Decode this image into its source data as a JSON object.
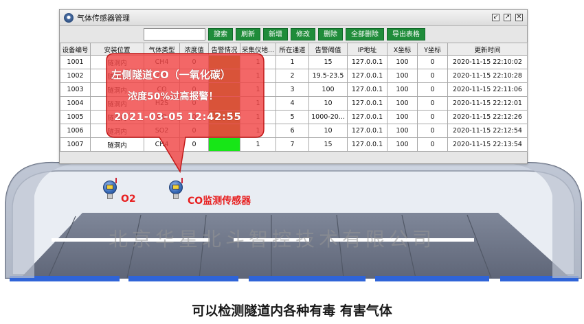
{
  "window": {
    "title": "气体传感器管理",
    "controls": [
      "↙",
      "↗",
      "✕"
    ]
  },
  "toolbar": {
    "search_value": "",
    "buttons": [
      "搜索",
      "刷新",
      "新增",
      "修改",
      "删除",
      "全部删除",
      "导出表格"
    ]
  },
  "table": {
    "headers": [
      "设备编号",
      "安装位置",
      "气体类型",
      "浓度值",
      "告警情况",
      "采集仪地...",
      "所在通道",
      "告警阈值",
      "IP地址",
      "X坐标",
      "Y坐标",
      "更新时间"
    ],
    "rows": [
      [
        "1001",
        "隧洞内",
        "CH4",
        "0",
        "",
        "1",
        "1",
        "15",
        "127.0.0.1",
        "100",
        "0",
        "2020-11-15 22:10:02"
      ],
      [
        "1002",
        "隧洞内",
        "O2",
        "2",
        "",
        "1",
        "2",
        "19.5-23.5",
        "127.0.0.1",
        "100",
        "0",
        "2020-11-15 22:10:28"
      ],
      [
        "1003",
        "隧洞内",
        "CO",
        "0",
        "",
        "1",
        "3",
        "100",
        "127.0.0.1",
        "100",
        "0",
        "2020-11-15 22:11:06"
      ],
      [
        "1004",
        "隧洞内",
        "H2S",
        "0",
        "",
        "1",
        "4",
        "10",
        "127.0.0.1",
        "100",
        "0",
        "2020-11-15 22:12:01"
      ],
      [
        "1005",
        "隧洞内",
        "CO",
        "0",
        "",
        "1",
        "5",
        "1000-20...",
        "127.0.0.1",
        "100",
        "0",
        "2020-11-15 22:12:26"
      ],
      [
        "1006",
        "隧洞内",
        "SO2",
        "0",
        "",
        "1",
        "6",
        "10",
        "127.0.0.1",
        "100",
        "0",
        "2020-11-15 22:12:54"
      ],
      [
        "1007",
        "隧洞内",
        "CH4",
        "0",
        "",
        "1",
        "7",
        "15",
        "127.0.0.1",
        "100",
        "0",
        "2020-11-15 22:13:54"
      ]
    ],
    "alarm_states": [
      "hot",
      "hot",
      "hot",
      "hot",
      "hot",
      "hot",
      "ok"
    ]
  },
  "alert": {
    "line1": "左侧隧道CO（一氧化碳）",
    "line2": "浓度50%过高报警！",
    "line3": "2021-03-05  12:42:55"
  },
  "sensors": {
    "o2_label": "O2",
    "co_label": "CO监测传感器"
  },
  "watermark": "北京华星北斗智控技术有限公司",
  "caption": "可以检测隧道内各种有毒 有害气体",
  "colors": {
    "alarm_ok": "#17e617",
    "alarm_hot": "#6e8f00",
    "button": "#1f8c3a",
    "callout": "#f04545",
    "lane": "#2f64d8"
  }
}
